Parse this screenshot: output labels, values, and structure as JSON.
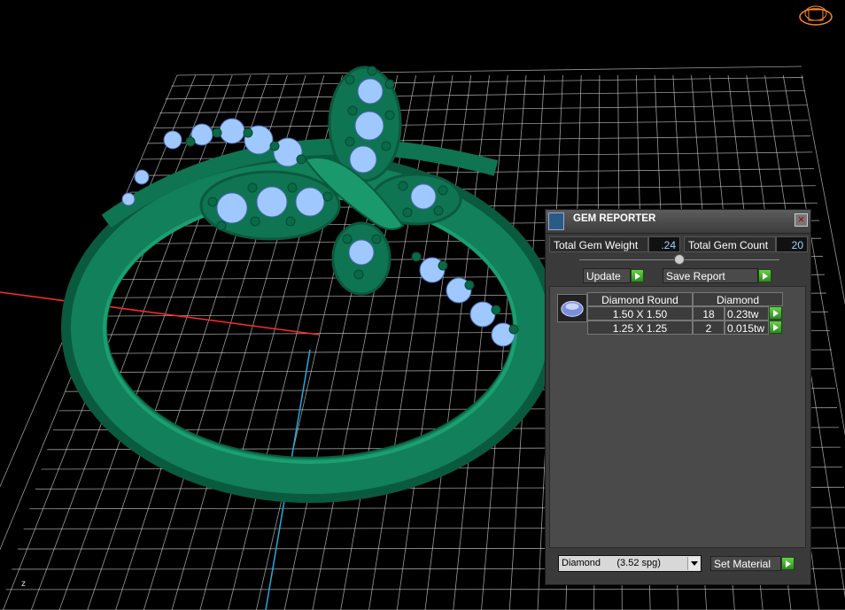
{
  "viewport": {
    "axis_label_z": "z",
    "ring_color": "#0e7050",
    "gem_color": "#9fc8ff",
    "grid_color": "#cfcfcf",
    "axis_x_color": "#ff2a2a",
    "axis_y_color": "#2aa8d8"
  },
  "panel": {
    "title": "GEM REPORTER",
    "close_label": "×",
    "total_weight_label": "Total Gem Weight",
    "total_weight_value": ".24",
    "total_count_label": "Total Gem Count",
    "total_count_value": "20",
    "update_label": "Update",
    "save_report_label": "Save Report",
    "table": {
      "headers": [
        "Diamond Round",
        "Diamond"
      ],
      "rows": [
        {
          "size": "1.50 X 1.50",
          "count": "18",
          "weight": "0.23tw"
        },
        {
          "size": "1.25 X 1.25",
          "count": "2",
          "weight": "0.015tw"
        }
      ]
    },
    "material_selected": "Diamond      (3.52 spg)",
    "set_material_label": "Set Material"
  }
}
